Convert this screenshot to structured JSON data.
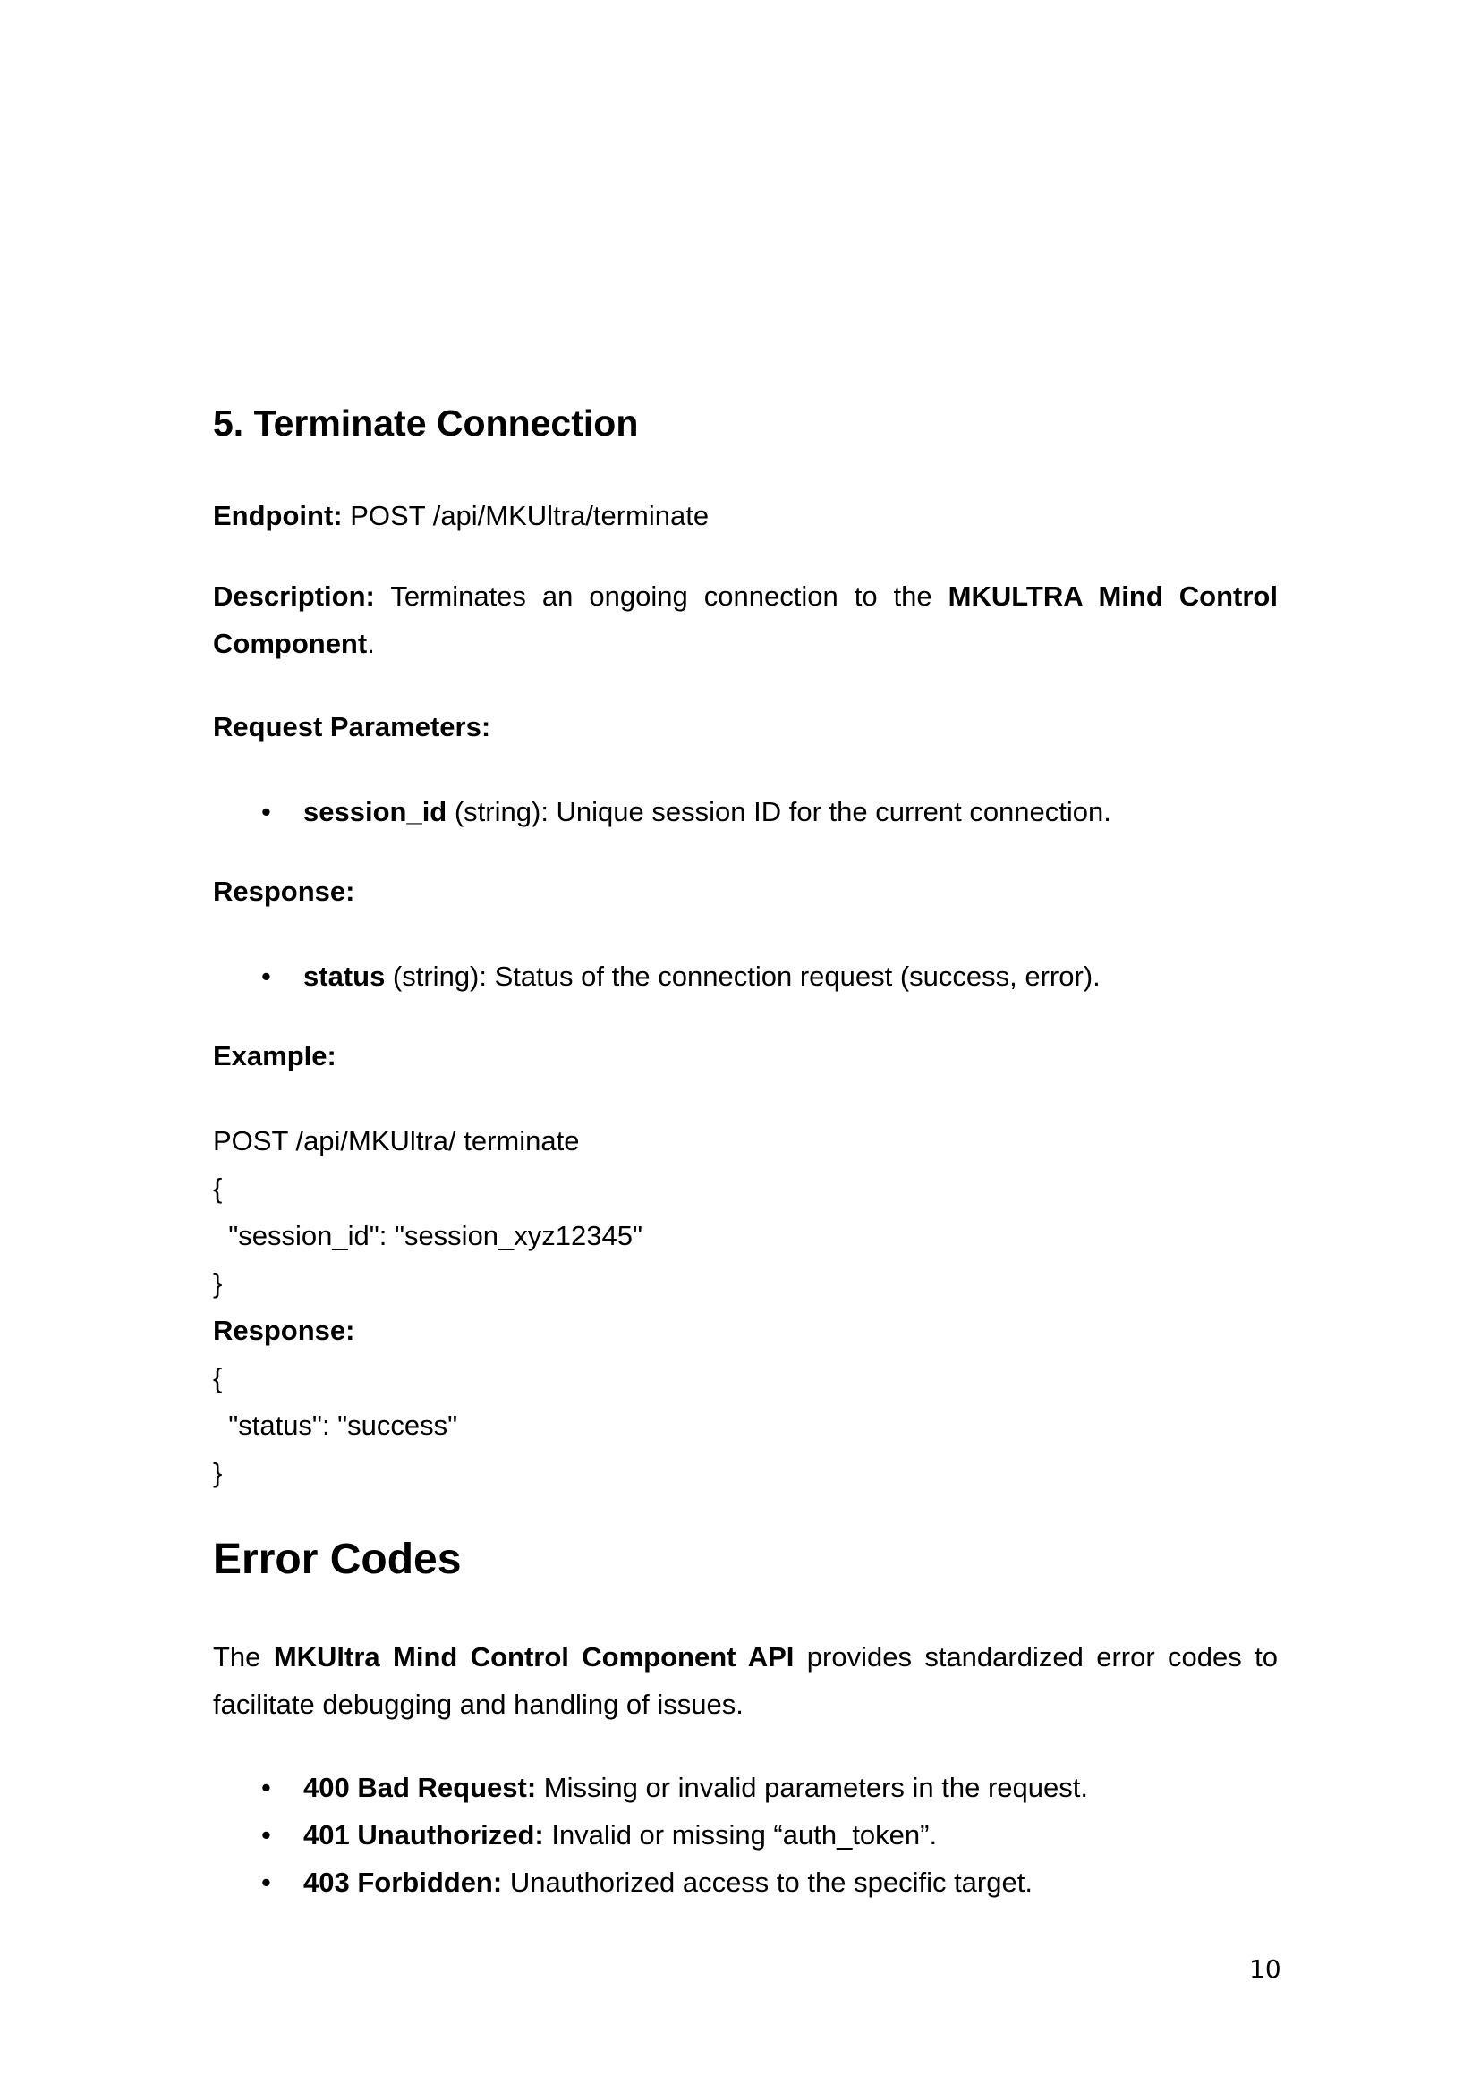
{
  "section": {
    "heading": "5. Terminate Connection",
    "endpoint": {
      "label": "Endpoint:",
      "value": "POST /api/MKUltra/terminate"
    },
    "description": {
      "label": "Description:",
      "text_before": "Terminates an ongoing connection to the",
      "bold_name": "MKULTRA Mind Control Component",
      "text_after": "."
    },
    "request_parameters": {
      "label": "Request Parameters:",
      "items": [
        {
          "name": "session_id",
          "detail": " (string): Unique session ID for the current connection."
        }
      ]
    },
    "response": {
      "label": "Response:",
      "items": [
        {
          "name": "status",
          "detail": " (string): Status of the connection request (success, error)."
        }
      ]
    },
    "example": {
      "label": "Example:",
      "request_lines": [
        "POST /api/MKUltra/ terminate",
        "{",
        "  \"session_id\": \"session_xyz12345\"",
        "}"
      ],
      "response_label": "Response:",
      "response_lines": [
        "{",
        "  \"status\": \"success\"",
        "}"
      ]
    }
  },
  "error_codes": {
    "heading": "Error Codes",
    "intro_before": "The",
    "intro_bold": "MKUltra Mind Control Component API",
    "intro_after_line1": "provides standardized error codes to",
    "intro_after_line2": "facilitate debugging and handling of issues.",
    "items": [
      {
        "code": "400 Bad Request:",
        "detail": " Missing or invalid parameters in the request."
      },
      {
        "code": "401 Unauthorized:",
        "detail": " Invalid or missing “auth_token”."
      },
      {
        "code": "403 Forbidden:",
        "detail": " Unauthorized access to the specific target."
      }
    ]
  },
  "bullet_glyph": "•",
  "page_number": "10"
}
